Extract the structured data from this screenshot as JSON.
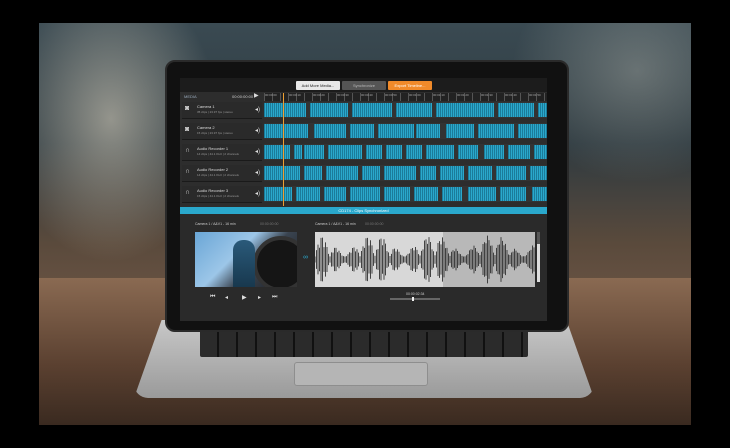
{
  "toolbar": {
    "add_media": "Add More Media...",
    "synchronize": "Synchronize",
    "export_timeline": "Export Timeline..."
  },
  "media_panel": {
    "label": "MEDIA",
    "timecode": "00:00:00:00"
  },
  "ruler_ticks": [
    "00:00:00",
    "00:00:10",
    "00:00:20",
    "00:00:30",
    "00:00:40",
    "00:00:50",
    "00:01:00",
    "00:01:10",
    "00:01:20",
    "00:01:30",
    "00:01:40",
    "00:01:50"
  ],
  "tracks": [
    {
      "name": "Camera 1",
      "info": "35 clips  |  23.97 fps  |  stereo",
      "icon": "camera-icon"
    },
    {
      "name": "Camera 2",
      "info": "15 clips  |  23.97 fps  |  stereo",
      "icon": "camera-icon"
    },
    {
      "name": "Audio Recorder 1",
      "info": "14 clips  |  44.1 KHz  |  2 channels",
      "icon": "headphones-icon"
    },
    {
      "name": "Audio Recorder 2",
      "info": "14 clips  |  44.1 KHz  |  2 channels",
      "icon": "headphones-icon"
    },
    {
      "name": "Audio Recorder 3",
      "info": "15 clips  |  44.1 KHz  |  2 channels",
      "icon": "headphones-icon"
    }
  ],
  "sync_status": "CD174 - Clips Synchronized",
  "viewer": {
    "left_label": "Camera 1 / A&V1 - 16 min",
    "left_tc": "00:00:00:00",
    "right_label": "Camera 1 / A&V1 - 16 min",
    "right_tc": "00:00:00:00",
    "current_tc": "00:00:02:34"
  },
  "colors": {
    "accent": "#2aa8cc",
    "export": "#f08a2a",
    "playhead": "#f0a030"
  }
}
